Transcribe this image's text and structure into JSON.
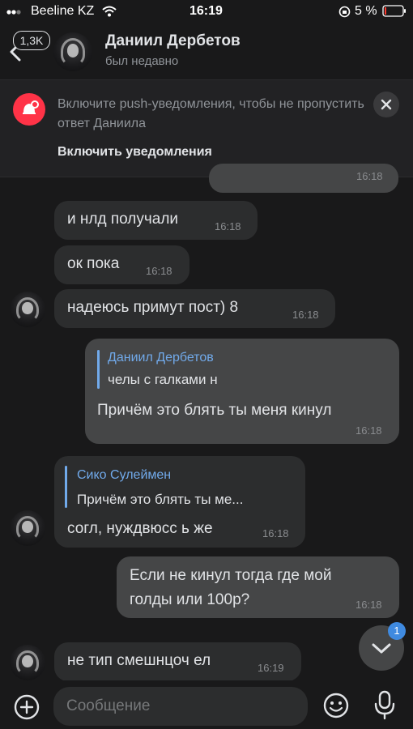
{
  "status_bar": {
    "carrier": "Beeline KZ",
    "time": "16:19",
    "battery": "5 %"
  },
  "header": {
    "unread_count": "1,3K",
    "name": "Даниил Дербетов",
    "status": "был недавно"
  },
  "push_banner": {
    "text": "Включите push-уведомления, чтобы не пропустить ответ Даниила",
    "action": "Включить уведомления"
  },
  "messages": [
    {
      "direction": "out",
      "text": "",
      "time": "16:18"
    },
    {
      "direction": "in",
      "text": "и нлд получали",
      "time": "16:18"
    },
    {
      "direction": "in",
      "text": "ок пока",
      "time": "16:18"
    },
    {
      "direction": "in",
      "text": "надеюсь примут пост) 8",
      "time": "16:18"
    },
    {
      "direction": "out",
      "reply_author": "Даниил Дербетов",
      "reply_text": "челы с галками н",
      "text": "Причём это блять ты меня кинул",
      "time": "16:18"
    },
    {
      "direction": "in",
      "reply_author": "Сико Сулеймен",
      "reply_text": "Причём это блять ты ме...",
      "text": "согл, нуждвюсс ь же",
      "time": "16:18"
    },
    {
      "direction": "out",
      "text_line1": "Если не кинул тогда где мой",
      "text_line2": "голды или 100р?",
      "time": "16:18"
    },
    {
      "direction": "in",
      "text": "не тип смешнцоч ел",
      "time": "16:19"
    }
  ],
  "scroll_button": {
    "unread": "1"
  },
  "composer": {
    "placeholder": "Сообщение"
  },
  "colors": {
    "background": "#19191a",
    "incoming": "#2c2d2e",
    "outgoing": "#454647",
    "accent": "#71aaeb",
    "push_icon": "#ff3347"
  }
}
